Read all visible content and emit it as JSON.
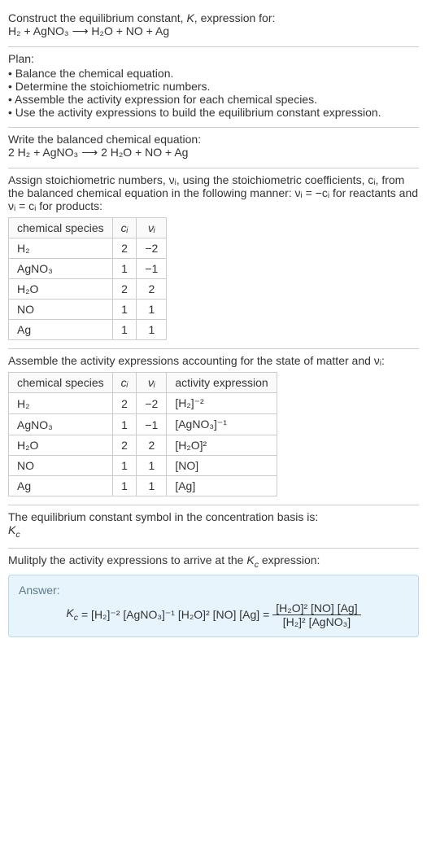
{
  "header": {
    "line1_prefix": "Construct the equilibrium constant, ",
    "line1_K": "K",
    "line1_suffix": ", expression for:",
    "equation_display": "H₂ + AgNO₃  ⟶  H₂O + NO + Ag"
  },
  "plan": {
    "label": "Plan:",
    "items": [
      "Balance the chemical equation.",
      "Determine the stoichiometric numbers.",
      "Assemble the activity expression for each chemical species.",
      "Use the activity expressions to build the equilibrium constant expression."
    ]
  },
  "balanced": {
    "label": "Write the balanced chemical equation:",
    "equation_display": "2 H₂ + AgNO₃  ⟶  2 H₂O + NO + Ag"
  },
  "assign": {
    "text": "Assign stoichiometric numbers, νᵢ, using the stoichiometric coefficients, cᵢ, from the balanced chemical equation in the following manner: νᵢ = −cᵢ for reactants and νᵢ = cᵢ for products:",
    "table": {
      "headers": {
        "species": "chemical species",
        "ci": "cᵢ",
        "vi": "νᵢ"
      },
      "rows": [
        {
          "species": "H₂",
          "ci": "2",
          "vi": "−2"
        },
        {
          "species": "AgNO₃",
          "ci": "1",
          "vi": "−1"
        },
        {
          "species": "H₂O",
          "ci": "2",
          "vi": "2"
        },
        {
          "species": "NO",
          "ci": "1",
          "vi": "1"
        },
        {
          "species": "Ag",
          "ci": "1",
          "vi": "1"
        }
      ]
    }
  },
  "activity": {
    "text": "Assemble the activity expressions accounting for the state of matter and νᵢ:",
    "table": {
      "headers": {
        "species": "chemical species",
        "ci": "cᵢ",
        "vi": "νᵢ",
        "expr": "activity expression"
      },
      "rows": [
        {
          "species": "H₂",
          "ci": "2",
          "vi": "−2",
          "expr": "[H₂]⁻²"
        },
        {
          "species": "AgNO₃",
          "ci": "1",
          "vi": "−1",
          "expr": "[AgNO₃]⁻¹"
        },
        {
          "species": "H₂O",
          "ci": "2",
          "vi": "2",
          "expr": "[H₂O]²"
        },
        {
          "species": "NO",
          "ci": "1",
          "vi": "1",
          "expr": "[NO]"
        },
        {
          "species": "Ag",
          "ci": "1",
          "vi": "1",
          "expr": "[Ag]"
        }
      ]
    }
  },
  "basis": {
    "text": "The equilibrium constant symbol in the concentration basis is:",
    "symbol": "K",
    "sub": "c"
  },
  "multiply": {
    "text_prefix": "Mulitply the activity expressions to arrive at the ",
    "symbol": "K",
    "sub": "c",
    "text_suffix": " expression:"
  },
  "answer": {
    "label": "Answer:",
    "lhs_symbol": "K",
    "lhs_sub": "c",
    "flat": "= [H₂]⁻² [AgNO₃]⁻¹ [H₂O]² [NO] [Ag] =",
    "frac_num": "[H₂O]² [NO] [Ag]",
    "frac_den": "[H₂]² [AgNO₃]"
  }
}
